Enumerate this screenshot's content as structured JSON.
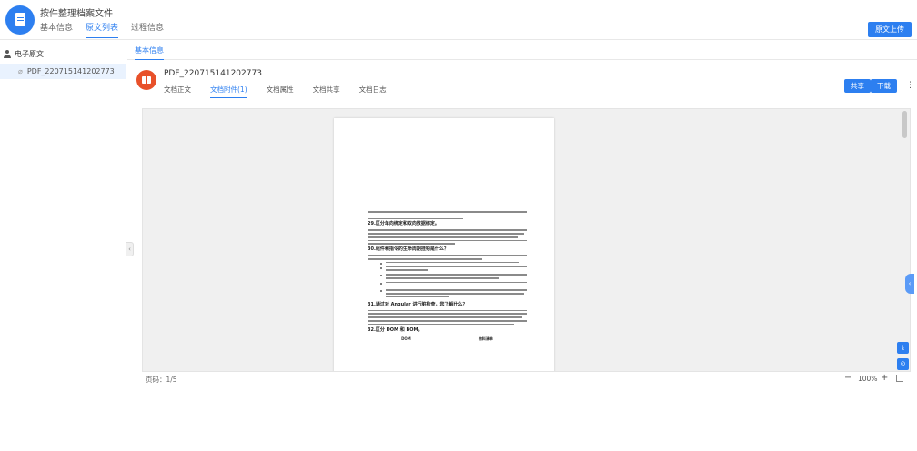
{
  "header": {
    "title": "按件整理档案文件",
    "tabs": [
      {
        "label": "基本信息",
        "active": false
      },
      {
        "label": "原文列表",
        "active": true
      },
      {
        "label": "过程信息",
        "active": false
      }
    ],
    "upload_label": "原文上传"
  },
  "sidebar": {
    "root_label": "电子原文",
    "items": [
      {
        "label": "PDF_220715141202773"
      }
    ]
  },
  "main": {
    "basic_tab": "基本信息",
    "file_name": "PDF_220715141202773",
    "doc_tabs": [
      {
        "label": "文档正文",
        "active": false
      },
      {
        "label": "文档附件(1)",
        "active": true
      },
      {
        "label": "文档属性",
        "active": false
      },
      {
        "label": "文档共享",
        "active": false
      },
      {
        "label": "文档日志",
        "active": false
      }
    ],
    "share_label": "共享",
    "download_label": "下载"
  },
  "viewer": {
    "headings": {
      "h29": "29.区分单向绑定和双向数据绑定。",
      "h30": "30.组件和指令的生命周期挂钩是什么？",
      "h31": "31.通过对 Angular 进行脏检查，您了解什么？",
      "h32": "32.区分 DOM 和 BOM。"
    },
    "table_headers": [
      "DOM",
      "物料清单"
    ],
    "page_label": "页码：1/5",
    "zoom": "100%"
  },
  "colors": {
    "accent": "#2d7ff0",
    "file_icon": "#e8512a"
  }
}
